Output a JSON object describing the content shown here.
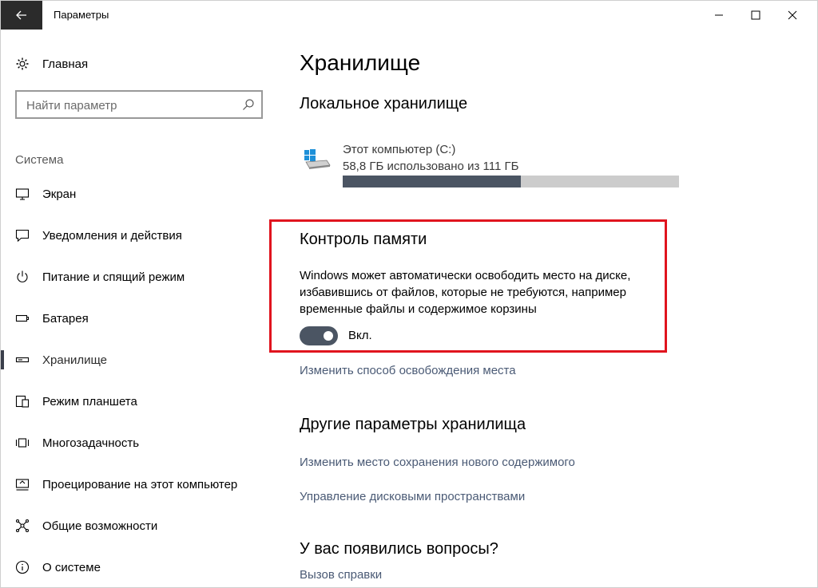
{
  "window": {
    "title": "Параметры"
  },
  "sidebar": {
    "home_label": "Главная",
    "search_placeholder": "Найти параметр",
    "section_label": "Система",
    "items": [
      {
        "label": "Экран",
        "icon": "monitor-icon"
      },
      {
        "label": "Уведомления и действия",
        "icon": "notifications-icon"
      },
      {
        "label": "Питание и спящий режим",
        "icon": "power-icon"
      },
      {
        "label": "Батарея",
        "icon": "battery-icon"
      },
      {
        "label": "Хранилище",
        "icon": "storage-icon",
        "active": true
      },
      {
        "label": "Режим планшета",
        "icon": "tablet-mode-icon"
      },
      {
        "label": "Многозадачность",
        "icon": "multitasking-icon"
      },
      {
        "label": "Проецирование на этот компьютер",
        "icon": "projecting-icon"
      },
      {
        "label": "Общие возможности",
        "icon": "shared-experiences-icon"
      },
      {
        "label": "О системе",
        "icon": "info-icon"
      }
    ]
  },
  "main": {
    "title": "Хранилище",
    "local_heading": "Локальное хранилище",
    "drive": {
      "name": "Этот компьютер (C:)",
      "usage": "58,8 ГБ использовано из 111 ГБ",
      "used_fraction": 0.53
    },
    "storage_sense": {
      "heading": "Контроль памяти",
      "description": "Windows может автоматически освободить место на диске, избавившись от файлов, которые не требуются, например временные файлы и содержимое корзины",
      "toggle_label": "Вкл.",
      "toggle_on": true
    },
    "change_free_link": "Изменить способ освобождения места",
    "other_heading": "Другие параметры хранилища",
    "change_save_link": "Изменить место сохранения нового содержимого",
    "manage_spaces_link": "Управление дисковыми пространствами",
    "faq_heading": "У вас появились вопросы?",
    "help_link": "Вызов справки"
  },
  "colors": {
    "accent_dark": "#4b5563",
    "highlight_border": "#e0141e",
    "link": "#4a5a75"
  }
}
